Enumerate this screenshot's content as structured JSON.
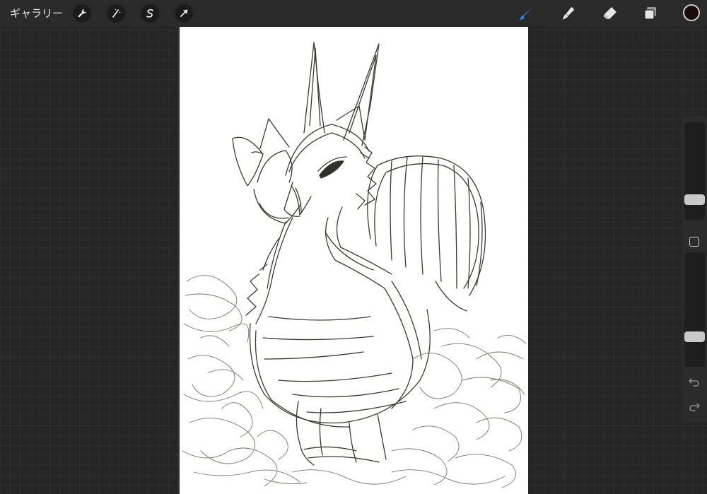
{
  "topbar": {
    "gallery_label": "ギャラリー",
    "left_tools": [
      {
        "icon": "wrench-icon",
        "name": "actions"
      },
      {
        "icon": "magic-wand-icon",
        "name": "adjustments"
      },
      {
        "icon": "selection-s-icon",
        "name": "selection"
      },
      {
        "icon": "arrow-cursor-icon",
        "name": "transform"
      }
    ],
    "right_tools": [
      {
        "icon": "brush-icon",
        "name": "paint",
        "active": true
      },
      {
        "icon": "smudge-icon",
        "name": "smudge",
        "active": false
      },
      {
        "icon": "eraser-icon",
        "name": "eraser",
        "active": false
      },
      {
        "icon": "layers-icon",
        "name": "layers",
        "active": false
      }
    ],
    "current_color": "#1a0a0a"
  },
  "colors": {
    "active_tool": "#2f8cff",
    "inactive_tool": "#e6e6e6",
    "canvas_background": "#ffffff",
    "sketch_stroke": "#2a2a22"
  },
  "sidebar": {
    "brush_size_level": 0.17,
    "opacity_level": 0.24
  }
}
